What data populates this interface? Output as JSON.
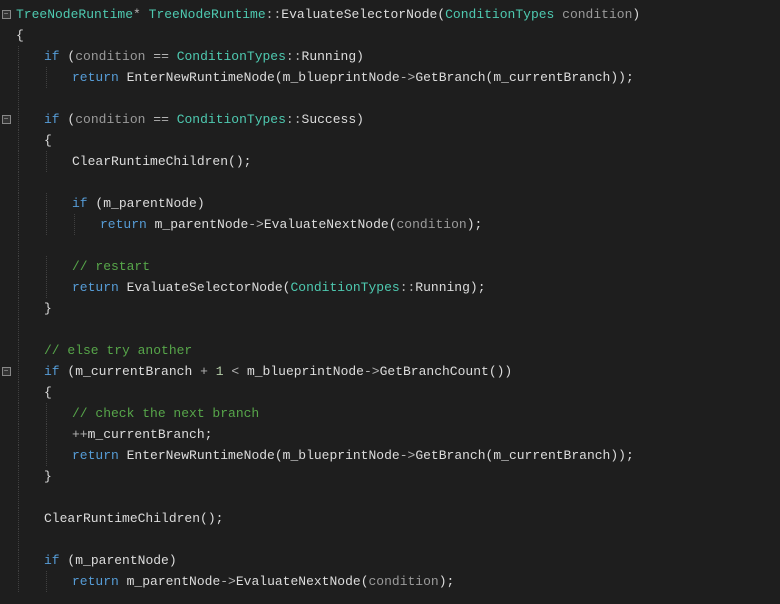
{
  "code": {
    "indentWidth": 28,
    "lines": [
      {
        "indent": 0,
        "fold": true,
        "tokens": [
          [
            "t-type",
            "TreeNodeRuntime"
          ],
          [
            "t-op",
            "* "
          ],
          [
            "t-class",
            "TreeNodeRuntime"
          ],
          [
            "t-op",
            "::"
          ],
          [
            "t-func",
            "EvaluateSelectorNode"
          ],
          [
            "t-punct",
            "("
          ],
          [
            "t-type",
            "ConditionTypes"
          ],
          [
            "t-ident",
            " "
          ],
          [
            "t-param",
            "condition"
          ],
          [
            "t-punct",
            ")"
          ]
        ]
      },
      {
        "indent": 0,
        "fold": false,
        "tokens": [
          [
            "t-punct",
            "{"
          ]
        ]
      },
      {
        "indent": 1,
        "fold": false,
        "tokens": [
          [
            "t-kw",
            "if"
          ],
          [
            "t-ident",
            " "
          ],
          [
            "t-punct",
            "("
          ],
          [
            "t-param",
            "condition"
          ],
          [
            "t-ident",
            " "
          ],
          [
            "t-op",
            "=="
          ],
          [
            "t-ident",
            " "
          ],
          [
            "t-type",
            "ConditionTypes"
          ],
          [
            "t-op",
            "::"
          ],
          [
            "t-ident",
            "Running"
          ],
          [
            "t-punct",
            ")"
          ]
        ]
      },
      {
        "indent": 2,
        "fold": false,
        "tokens": [
          [
            "t-kw",
            "return"
          ],
          [
            "t-ident",
            " "
          ],
          [
            "t-func",
            "EnterNewRuntimeNode"
          ],
          [
            "t-punct",
            "("
          ],
          [
            "t-member",
            "m_blueprintNode"
          ],
          [
            "t-op",
            "->"
          ],
          [
            "t-func",
            "GetBranch"
          ],
          [
            "t-punct",
            "("
          ],
          [
            "t-member",
            "m_currentBranch"
          ],
          [
            "t-punct",
            "));"
          ]
        ]
      },
      {
        "indent": 0,
        "fold": false,
        "tokens": []
      },
      {
        "indent": 1,
        "fold": true,
        "tokens": [
          [
            "t-kw",
            "if"
          ],
          [
            "t-ident",
            " "
          ],
          [
            "t-punct",
            "("
          ],
          [
            "t-param",
            "condition"
          ],
          [
            "t-ident",
            " "
          ],
          [
            "t-op",
            "=="
          ],
          [
            "t-ident",
            " "
          ],
          [
            "t-type",
            "ConditionTypes"
          ],
          [
            "t-op",
            "::"
          ],
          [
            "t-ident",
            "Success"
          ],
          [
            "t-punct",
            ")"
          ]
        ]
      },
      {
        "indent": 1,
        "fold": false,
        "tokens": [
          [
            "t-punct",
            "{"
          ]
        ]
      },
      {
        "indent": 2,
        "fold": false,
        "tokens": [
          [
            "t-func",
            "ClearRuntimeChildren"
          ],
          [
            "t-punct",
            "();"
          ]
        ]
      },
      {
        "indent": 0,
        "fold": false,
        "tokens": []
      },
      {
        "indent": 2,
        "fold": false,
        "tokens": [
          [
            "t-kw",
            "if"
          ],
          [
            "t-ident",
            " "
          ],
          [
            "t-punct",
            "("
          ],
          [
            "t-member",
            "m_parentNode"
          ],
          [
            "t-punct",
            ")"
          ]
        ]
      },
      {
        "indent": 3,
        "fold": false,
        "tokens": [
          [
            "t-kw",
            "return"
          ],
          [
            "t-ident",
            " "
          ],
          [
            "t-member",
            "m_parentNode"
          ],
          [
            "t-op",
            "->"
          ],
          [
            "t-func",
            "EvaluateNextNode"
          ],
          [
            "t-punct",
            "("
          ],
          [
            "t-param",
            "condition"
          ],
          [
            "t-punct",
            ");"
          ]
        ]
      },
      {
        "indent": 0,
        "fold": false,
        "tokens": []
      },
      {
        "indent": 2,
        "fold": false,
        "tokens": [
          [
            "t-comment",
            "// restart"
          ]
        ]
      },
      {
        "indent": 2,
        "fold": false,
        "tokens": [
          [
            "t-kw",
            "return"
          ],
          [
            "t-ident",
            " "
          ],
          [
            "t-func",
            "EvaluateSelectorNode"
          ],
          [
            "t-punct",
            "("
          ],
          [
            "t-type",
            "ConditionTypes"
          ],
          [
            "t-op",
            "::"
          ],
          [
            "t-ident",
            "Running"
          ],
          [
            "t-punct",
            ");"
          ]
        ]
      },
      {
        "indent": 1,
        "fold": false,
        "tokens": [
          [
            "t-punct",
            "}"
          ]
        ]
      },
      {
        "indent": 0,
        "fold": false,
        "tokens": []
      },
      {
        "indent": 1,
        "fold": false,
        "tokens": [
          [
            "t-comment",
            "// else try another"
          ]
        ]
      },
      {
        "indent": 1,
        "fold": true,
        "tokens": [
          [
            "t-kw",
            "if"
          ],
          [
            "t-ident",
            " "
          ],
          [
            "t-punct",
            "("
          ],
          [
            "t-member",
            "m_currentBranch"
          ],
          [
            "t-ident",
            " "
          ],
          [
            "t-op",
            "+"
          ],
          [
            "t-ident",
            " "
          ],
          [
            "t-num",
            "1"
          ],
          [
            "t-ident",
            " "
          ],
          [
            "t-op",
            "<"
          ],
          [
            "t-ident",
            " "
          ],
          [
            "t-member",
            "m_blueprintNode"
          ],
          [
            "t-op",
            "->"
          ],
          [
            "t-func",
            "GetBranchCount"
          ],
          [
            "t-punct",
            "())"
          ]
        ]
      },
      {
        "indent": 1,
        "fold": false,
        "tokens": [
          [
            "t-punct",
            "{"
          ]
        ]
      },
      {
        "indent": 2,
        "fold": false,
        "tokens": [
          [
            "t-comment",
            "// check the next branch"
          ]
        ]
      },
      {
        "indent": 2,
        "fold": false,
        "tokens": [
          [
            "t-op",
            "++"
          ],
          [
            "t-member",
            "m_currentBranch"
          ],
          [
            "t-punct",
            ";"
          ]
        ]
      },
      {
        "indent": 2,
        "fold": false,
        "tokens": [
          [
            "t-kw",
            "return"
          ],
          [
            "t-ident",
            " "
          ],
          [
            "t-func",
            "EnterNewRuntimeNode"
          ],
          [
            "t-punct",
            "("
          ],
          [
            "t-member",
            "m_blueprintNode"
          ],
          [
            "t-op",
            "->"
          ],
          [
            "t-func",
            "GetBranch"
          ],
          [
            "t-punct",
            "("
          ],
          [
            "t-member",
            "m_currentBranch"
          ],
          [
            "t-punct",
            "));"
          ]
        ]
      },
      {
        "indent": 1,
        "fold": false,
        "tokens": [
          [
            "t-punct",
            "}"
          ]
        ]
      },
      {
        "indent": 0,
        "fold": false,
        "tokens": []
      },
      {
        "indent": 1,
        "fold": false,
        "tokens": [
          [
            "t-func",
            "ClearRuntimeChildren"
          ],
          [
            "t-punct",
            "();"
          ]
        ]
      },
      {
        "indent": 0,
        "fold": false,
        "tokens": []
      },
      {
        "indent": 1,
        "fold": false,
        "tokens": [
          [
            "t-kw",
            "if"
          ],
          [
            "t-ident",
            " "
          ],
          [
            "t-punct",
            "("
          ],
          [
            "t-member",
            "m_parentNode"
          ],
          [
            "t-punct",
            ")"
          ]
        ]
      },
      {
        "indent": 2,
        "fold": false,
        "tokens": [
          [
            "t-kw",
            "return"
          ],
          [
            "t-ident",
            " "
          ],
          [
            "t-member",
            "m_parentNode"
          ],
          [
            "t-op",
            "->"
          ],
          [
            "t-func",
            "EvaluateNextNode"
          ],
          [
            "t-punct",
            "("
          ],
          [
            "t-param",
            "condition"
          ],
          [
            "t-punct",
            ");"
          ]
        ]
      }
    ]
  }
}
